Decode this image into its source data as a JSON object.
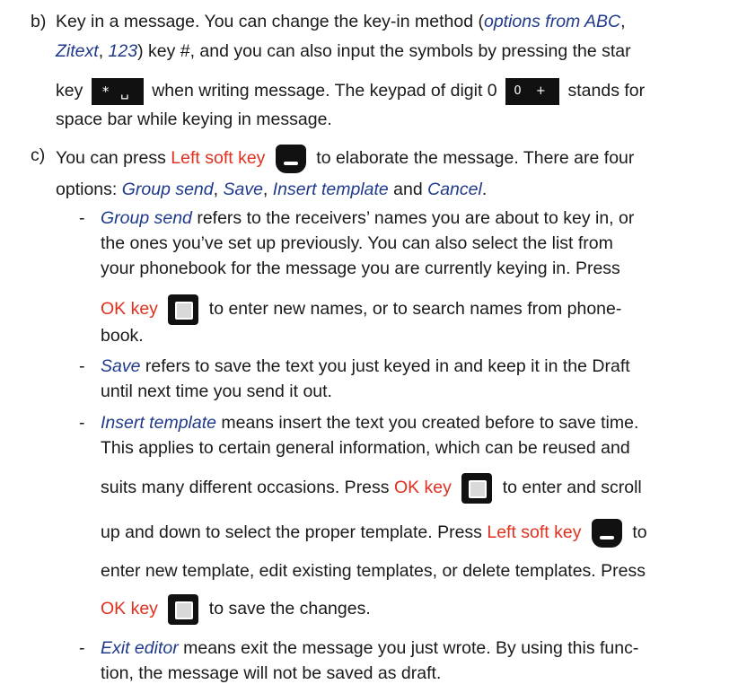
{
  "item_b": {
    "marker": "b)",
    "l1_pre": "Key in a message. You can change the key-in method (",
    "l1_opt": "options from ABC",
    "l1_post": ",",
    "l2_zitext": "Zitext",
    "l2_sep": ", ",
    "l2_123": "123",
    "l2_post": ") key #, and you can also input the symbols by pressing the star",
    "l3_a": "key",
    "star_key": "* ␣",
    "l3_b": "when writing message. The keypad of digit 0",
    "zero_key": "0 +",
    "l3_c": "stands for",
    "l4": "space bar while keying in message."
  },
  "item_c": {
    "marker": "c)",
    "l1_a": "You can press ",
    "l1_left": "Left soft key",
    "l1_b": "to elaborate the message. There are four",
    "l2_a": "options: ",
    "opt_group": "Group send",
    "sep1": ", ",
    "opt_save": "Save",
    "sep2": ", ",
    "opt_insert": "Insert template",
    "sep3": " and ",
    "opt_cancel": "Cancel",
    "end": "."
  },
  "sub_group": {
    "dash": "-",
    "term": "Group send",
    "l1": " refers to the receivers’ names you are about to key in, or",
    "l2": "the ones you’ve set up previously. You can also select the list from",
    "l3": "your phonebook for the message you are currently keying in. Press",
    "ok": "OK key",
    "l4": "to enter new names, or to search names from phone-",
    "l5": "book."
  },
  "sub_save": {
    "dash": "-",
    "term": "Save",
    "l1": " refers to save the text you just keyed in and keep it in the Draft",
    "l2": "until next time you send it out."
  },
  "sub_insert": {
    "dash": "-",
    "term": "Insert template",
    "l1": " means insert the text you created before to save time.",
    "l2": "This applies to certain general information, which can be reused and",
    "l3_a": "suits many different occasions. Press ",
    "ok1": "OK key",
    "l3_b": "to enter and scroll",
    "l4_a": "up and down to select the proper template. Press ",
    "left": "Left soft key",
    "l4_b": "to",
    "l5": "enter new template, edit existing templates, or delete templates. Press",
    "ok2": "OK key",
    "l6": "to save the changes."
  },
  "sub_exit": {
    "dash": "-",
    "term": "Exit editor",
    "l1": " means exit the message you just wrote. By using this func-",
    "l2": "tion, the message will not be saved as draft."
  }
}
